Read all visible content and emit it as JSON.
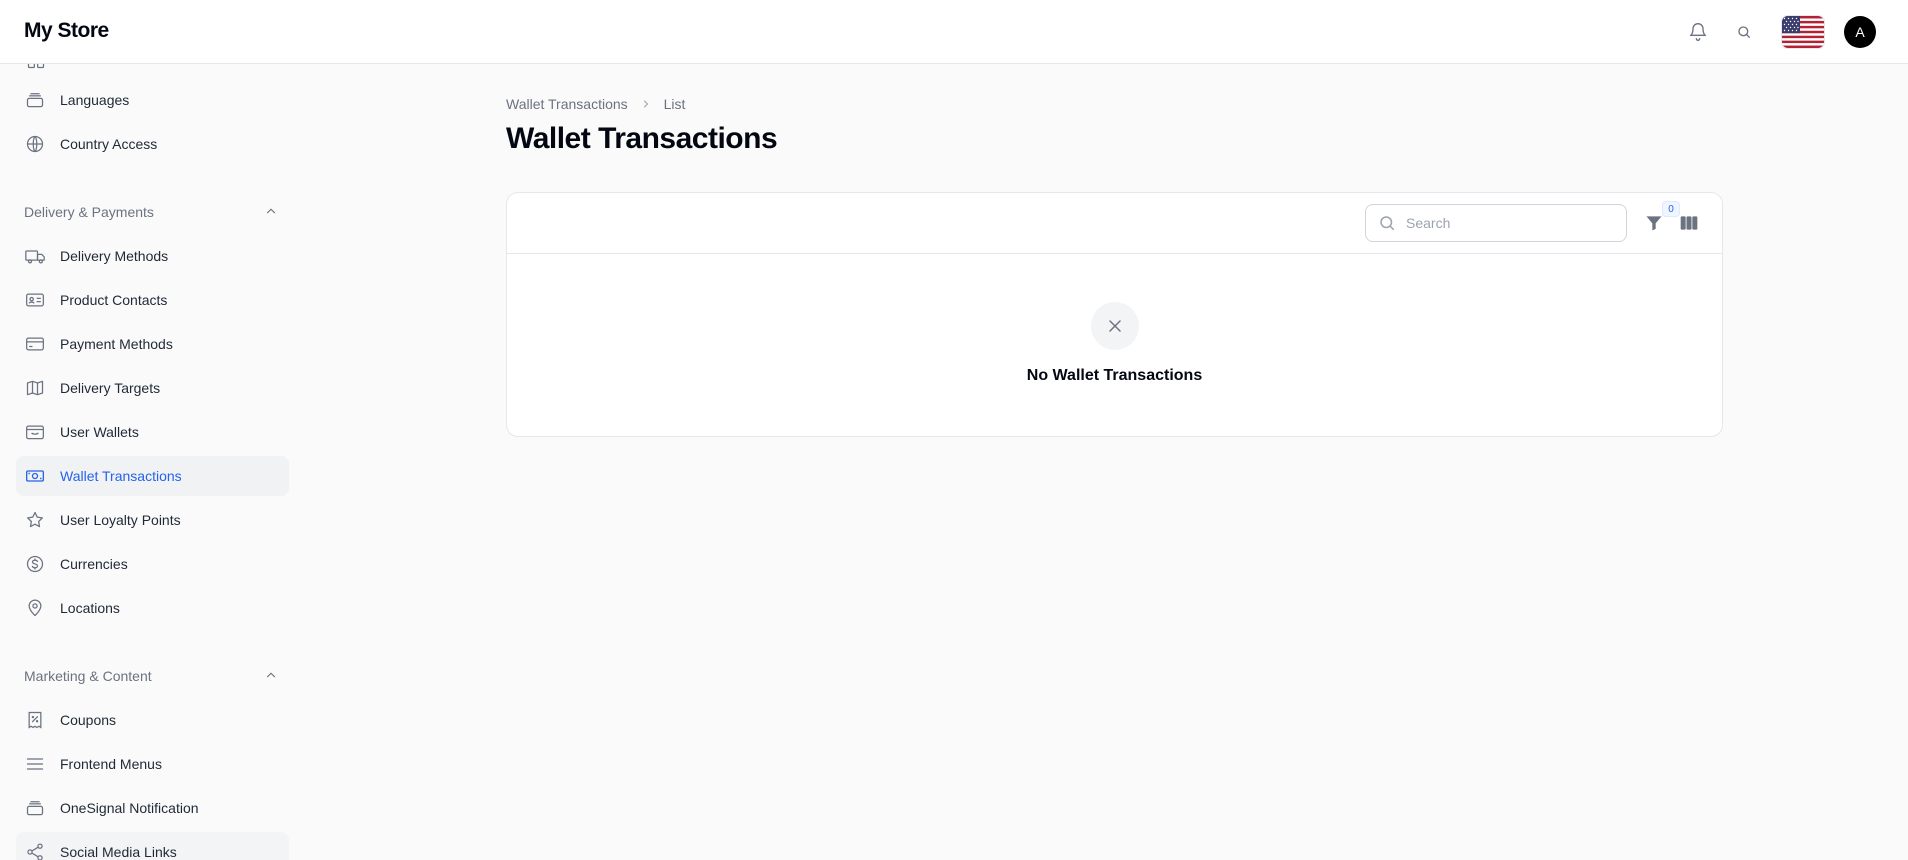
{
  "app": {
    "title": "My Store"
  },
  "topbar": {
    "avatar_initial": "A",
    "icons": [
      "bell-icon",
      "search-icon",
      "us-flag-icon"
    ]
  },
  "sidebar": {
    "items_top": [
      {
        "label": "Languages",
        "icon": "stack-icon"
      },
      {
        "label": "Country Access",
        "icon": "globe-icon"
      }
    ],
    "groups": [
      {
        "label": "Delivery & Payments",
        "items": [
          {
            "label": "Delivery Methods",
            "icon": "truck-icon"
          },
          {
            "label": "Product Contacts",
            "icon": "contact-card-icon"
          },
          {
            "label": "Payment Methods",
            "icon": "credit-card-icon"
          },
          {
            "label": "Delivery Targets",
            "icon": "map-icon"
          },
          {
            "label": "User Wallets",
            "icon": "wallet-icon"
          },
          {
            "label": "Wallet Transactions",
            "icon": "cash-icon",
            "active": true
          },
          {
            "label": "User Loyalty Points",
            "icon": "star-icon"
          },
          {
            "label": "Currencies",
            "icon": "dollar-circle-icon"
          },
          {
            "label": "Locations",
            "icon": "map-pin-icon"
          }
        ]
      },
      {
        "label": "Marketing & Content",
        "items": [
          {
            "label": "Coupons",
            "icon": "receipt-percent-icon"
          },
          {
            "label": "Frontend Menus",
            "icon": "menu-lines-icon"
          },
          {
            "label": "OneSignal Notification",
            "icon": "stack-icon"
          },
          {
            "label": "Social Media Links",
            "icon": "share-icon"
          }
        ]
      }
    ]
  },
  "breadcrumb": {
    "parent": "Wallet Transactions",
    "current": "List"
  },
  "page": {
    "title": "Wallet Transactions"
  },
  "table": {
    "search_placeholder": "Search",
    "filter_count": "0",
    "empty_message": "No Wallet Transactions"
  },
  "colors": {
    "accent": "#2563eb",
    "active_bg": "#f1f2f4",
    "border": "#e5e7eb"
  }
}
